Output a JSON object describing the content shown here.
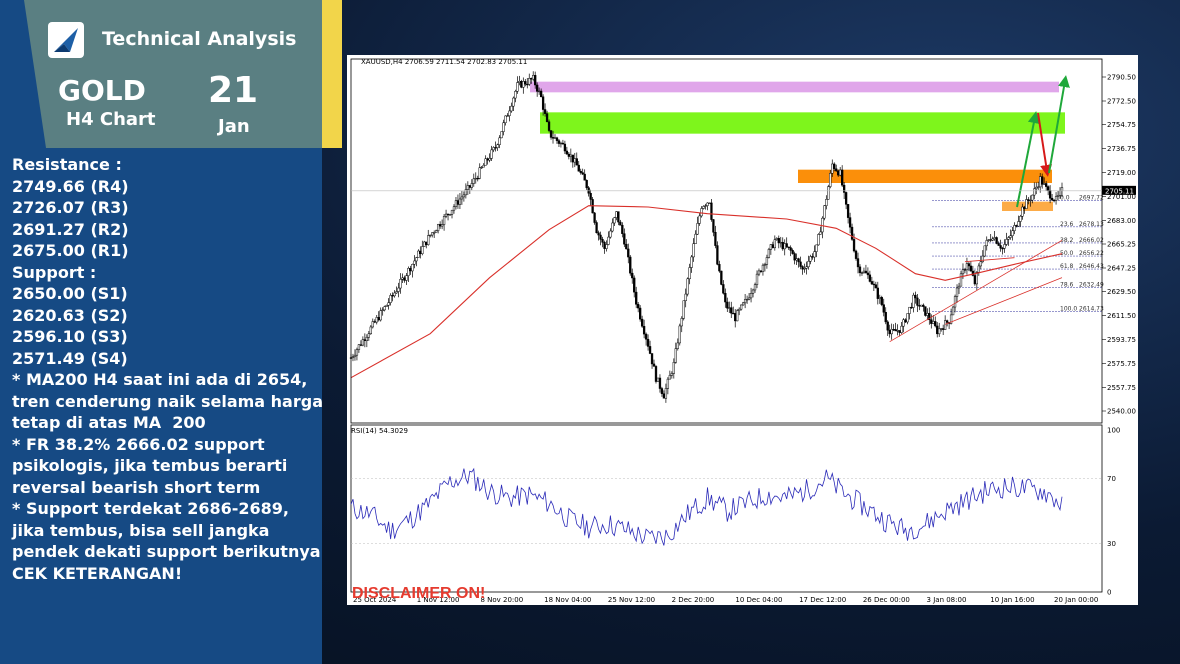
{
  "header": {
    "brand": "Technical Analysis",
    "asset": "GOLD",
    "timeframe": "H4 Chart",
    "day": "21",
    "month": "Jan"
  },
  "notes": [
    "Resistance :",
    "2749.66 (R4)",
    "2726.07 (R3)",
    "2691.27 (R2)",
    "2675.00 (R1)",
    "",
    "Support :",
    "2650.00 (S1)",
    "2620.63 (S2)",
    "2596.10 (S3)",
    "2571.49 (S4)",
    "",
    "* MA200 H4 saat ini ada di 2654,",
    "tren cenderung naik selama harga",
    "tetap di atas MA  200",
    "* FR 38.2% 2666.02 support",
    "psikologis, jika tembus berarti",
    "reversal bearish short term",
    "* Support terdekat 2686-2689,",
    "jika tembus, bisa sell jangka",
    "pendek dekati support berikutnya",
    "CEK KETERANGAN!"
  ],
  "disclaimer": "DISCLAIMER ON!",
  "colors": {
    "zone_purple": "#e0a6ea",
    "zone_green": "#7ef51c",
    "zone_orange": "#fb8f0a",
    "ma_line": "#d9302a",
    "rsi_line": "#2b2bb8",
    "arrow_up": "#1fa83a",
    "arrow_down": "#d61a1a"
  },
  "chart_data": [
    {
      "type": "candlestick",
      "title": "XAUUSD,H4  2706.59 2711.54 2702.83 2705.11",
      "current_price_label": "2705.11",
      "y_ticks": [
        2790.5,
        2772.5,
        2754.75,
        2736.75,
        2719.0,
        2701.0,
        2683.0,
        2665.25,
        2647.25,
        2629.5,
        2611.5,
        2593.75,
        2575.75,
        2557.75,
        2540.0
      ],
      "y_tick_labels": [
        "2790.50",
        "2772.50",
        "2754.75",
        "2736.75",
        "2719.00",
        "2701.00",
        "2683.00",
        "2665.25",
        "2647.25",
        "2629.50",
        "2611.50",
        "2593.75",
        "2575.75",
        "2557.75",
        "2540.00"
      ],
      "ylim": [
        2531,
        2798
      ],
      "x_labels": [
        "25 Oct 2024",
        "1 Nov 12:00",
        "8 Nov 20:00",
        "18 Nov 04:00",
        "25 Nov 12:00",
        "2 Dec 20:00",
        "10 Dec 04:00",
        "17 Dec 12:00",
        "26 Dec 00:00",
        "3 Jan 08:00",
        "10 Jan 16:00",
        "20 Jan 00:00"
      ],
      "price_path": [
        [
          0,
          2580
        ],
        [
          20,
          2624
        ],
        [
          40,
          2672
        ],
        [
          60,
          2708
        ],
        [
          73,
          2738
        ],
        [
          84,
          2784
        ],
        [
          92,
          2789
        ],
        [
          96,
          2775
        ],
        [
          100,
          2748
        ],
        [
          108,
          2738
        ],
        [
          114,
          2724
        ],
        [
          120,
          2706
        ],
        [
          124,
          2676
        ],
        [
          128,
          2662
        ],
        [
          134,
          2688
        ],
        [
          138,
          2668
        ],
        [
          144,
          2622
        ],
        [
          150,
          2590
        ],
        [
          154,
          2565
        ],
        [
          158,
          2552
        ],
        [
          163,
          2575
        ],
        [
          168,
          2620
        ],
        [
          173,
          2664
        ],
        [
          177,
          2694
        ],
        [
          181,
          2698
        ],
        [
          185,
          2650
        ],
        [
          189,
          2620
        ],
        [
          194,
          2610
        ],
        [
          200,
          2624
        ],
        [
          208,
          2650
        ],
        [
          214,
          2668
        ],
        [
          222,
          2660
        ],
        [
          228,
          2646
        ],
        [
          235,
          2662
        ],
        [
          240,
          2700
        ],
        [
          243,
          2725
        ],
        [
          247,
          2718
        ],
        [
          251,
          2684
        ],
        [
          256,
          2648
        ],
        [
          262,
          2640
        ],
        [
          268,
          2620
        ],
        [
          272,
          2598
        ],
        [
          278,
          2602
        ],
        [
          284,
          2624
        ],
        [
          290,
          2614
        ],
        [
          296,
          2600
        ],
        [
          302,
          2608
        ],
        [
          307,
          2636
        ],
        [
          311,
          2652
        ],
        [
          315,
          2636
        ],
        [
          320,
          2664
        ],
        [
          324,
          2672
        ],
        [
          329,
          2662
        ],
        [
          334,
          2674
        ],
        [
          339,
          2692
        ],
        [
          344,
          2702
        ],
        [
          348,
          2714
        ],
        [
          352,
          2704
        ],
        [
          356,
          2698
        ],
        [
          359,
          2705
        ]
      ],
      "ma200_path": [
        [
          0,
          2565
        ],
        [
          40,
          2598
        ],
        [
          70,
          2640
        ],
        [
          100,
          2676
        ],
        [
          120,
          2694
        ],
        [
          150,
          2693
        ],
        [
          180,
          2688
        ],
        [
          220,
          2684
        ],
        [
          245,
          2677
        ],
        [
          265,
          2662
        ],
        [
          285,
          2643
        ],
        [
          300,
          2638
        ],
        [
          315,
          2643
        ],
        [
          335,
          2650
        ],
        [
          359,
          2658
        ]
      ],
      "zones": [
        {
          "name": "purple",
          "top": 2787,
          "bottom": 2779
        },
        {
          "name": "green",
          "top": 2764,
          "bottom": 2748
        },
        {
          "name": "orange",
          "top": 2721,
          "bottom": 2711
        },
        {
          "name": "orange-small",
          "top": 2697,
          "bottom": 2690
        }
      ],
      "fibonacci": [
        {
          "level": "0.0",
          "price": "2697.72"
        },
        {
          "level": "23.6",
          "price": "2678.13"
        },
        {
          "level": "38.2",
          "price": "2666.02"
        },
        {
          "level": "50.0",
          "price": "2656.22"
        },
        {
          "level": "61.8",
          "price": "2646.43"
        },
        {
          "level": "78.6",
          "price": "2632.49"
        },
        {
          "level": "100.0",
          "price": "2614.73"
        }
      ],
      "rsi": {
        "label": "RSI(14) 54.3029",
        "y_ticks": [
          100,
          70,
          30,
          0
        ],
        "path": [
          [
            0,
            52
          ],
          [
            10,
            48
          ],
          [
            20,
            38
          ],
          [
            30,
            45
          ],
          [
            40,
            55
          ],
          [
            50,
            68
          ],
          [
            60,
            72
          ],
          [
            70,
            62
          ],
          [
            80,
            58
          ],
          [
            90,
            60
          ],
          [
            100,
            55
          ],
          [
            110,
            45
          ],
          [
            120,
            40
          ],
          [
            130,
            42
          ],
          [
            140,
            38
          ],
          [
            150,
            33
          ],
          [
            160,
            35
          ],
          [
            170,
            48
          ],
          [
            180,
            58
          ],
          [
            190,
            50
          ],
          [
            200,
            55
          ],
          [
            210,
            60
          ],
          [
            220,
            58
          ],
          [
            230,
            63
          ],
          [
            240,
            70
          ],
          [
            250,
            60
          ],
          [
            260,
            52
          ],
          [
            270,
            44
          ],
          [
            280,
            38
          ],
          [
            290,
            42
          ],
          [
            300,
            50
          ],
          [
            310,
            56
          ],
          [
            320,
            62
          ],
          [
            330,
            65
          ],
          [
            340,
            64
          ],
          [
            350,
            62
          ],
          [
            359,
            54
          ]
        ]
      }
    }
  ]
}
